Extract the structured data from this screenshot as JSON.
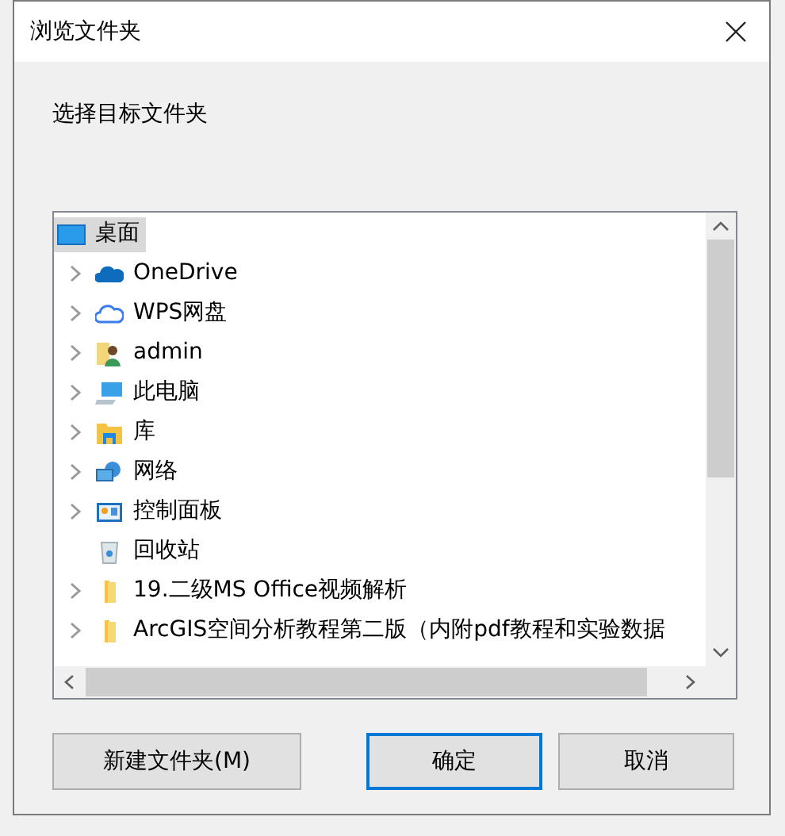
{
  "window": {
    "title": "浏览文件夹"
  },
  "prompt": "选择目标文件夹",
  "tree": {
    "items": [
      {
        "label": "桌面",
        "kind": "desktop",
        "expandable": false,
        "selected": true
      },
      {
        "label": "OneDrive",
        "kind": "cloud",
        "expandable": true,
        "selected": false
      },
      {
        "label": "WPS网盘",
        "kind": "outline",
        "expandable": true,
        "selected": false
      },
      {
        "label": "admin",
        "kind": "user",
        "expandable": true,
        "selected": false
      },
      {
        "label": "此电脑",
        "kind": "computer",
        "expandable": true,
        "selected": false
      },
      {
        "label": "库",
        "kind": "library",
        "expandable": true,
        "selected": false
      },
      {
        "label": "网络",
        "kind": "network",
        "expandable": true,
        "selected": false
      },
      {
        "label": "控制面板",
        "kind": "panel",
        "expandable": true,
        "selected": false
      },
      {
        "label": "回收站",
        "kind": "bin",
        "expandable": false,
        "selected": false
      },
      {
        "label": "19.二级MS Office视频解析",
        "kind": "folder",
        "expandable": true,
        "selected": false
      },
      {
        "label": "ArcGIS空间分析教程第二版（内附pdf教程和实验数据",
        "kind": "folder",
        "expandable": true,
        "selected": false
      }
    ]
  },
  "buttons": [
    {
      "label": "新建文件夹(M)",
      "default": false
    },
    {
      "label": "确定",
      "default": true
    },
    {
      "label": "取消",
      "default": false
    }
  ]
}
